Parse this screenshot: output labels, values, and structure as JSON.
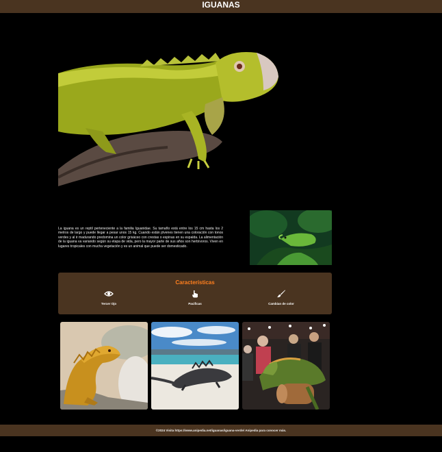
{
  "header": {
    "title": "IGUANAS"
  },
  "intro": {
    "text": "La iguana es un reptil perteneciente a la familia Iguanidae. Su tamaño está entre los 15 cm hasta los 2 metros de largo y puede llegar a pesar unos 15 kg. Cuando están jóvenes tienen una coloración con tonos verdes y al ir madurando predomina un color grisáceo con crestas o espinas en su espalda. La alimentación de la iguana va variando según su etapa de vida, pero la mayor parte de sus años son herbívoros. Viven en lugares tropicales con mucha vegetación y es un animal que puede ser domesticado."
  },
  "features": {
    "title": "Características",
    "items": [
      {
        "icon": "eye-icon",
        "label": "Tercer Ojo"
      },
      {
        "icon": "hand-pointer-icon",
        "label": "Pacificas"
      },
      {
        "icon": "paintbrush-icon",
        "label": "Cambian de color"
      }
    ]
  },
  "footer": {
    "text": "©2024 Visita https://www.anipedia.net/iguanas/iguana-verde/ Anipedia para conocer más."
  },
  "colors": {
    "bar": "#4a3420",
    "accent": "#ff7f1e",
    "background": "#000000"
  }
}
